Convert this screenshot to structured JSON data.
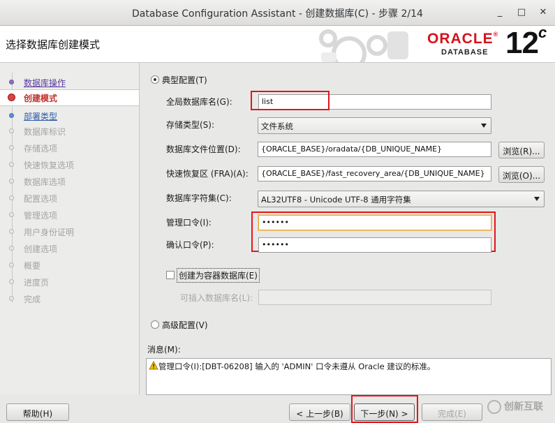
{
  "window": {
    "title": "Database Configuration Assistant - 创建数据库(C) - 步骤 2/14",
    "minimize": "_",
    "maximize": "□",
    "close": "✕"
  },
  "header": {
    "heading": "选择数据库创建模式",
    "logo_oracle": "ORACLE",
    "logo_registered": "®",
    "logo_database": "DATABASE",
    "logo_version": "12",
    "logo_version_suffix": "c"
  },
  "nav": {
    "steps": [
      {
        "label": "数据库操作",
        "state": "done"
      },
      {
        "label": "创建模式",
        "state": "current"
      },
      {
        "label": "部署类型",
        "state": "link"
      },
      {
        "label": "数据库标识",
        "state": "disabled"
      },
      {
        "label": "存储选项",
        "state": "disabled"
      },
      {
        "label": "快速恢复选项",
        "state": "disabled"
      },
      {
        "label": "数据库选项",
        "state": "disabled"
      },
      {
        "label": "配置选项",
        "state": "disabled"
      },
      {
        "label": "管理选项",
        "state": "disabled"
      },
      {
        "label": "用户身份证明",
        "state": "disabled"
      },
      {
        "label": "创建选项",
        "state": "disabled"
      },
      {
        "label": "概要",
        "state": "disabled"
      },
      {
        "label": "进度页",
        "state": "disabled"
      },
      {
        "label": "完成",
        "state": "disabled"
      }
    ]
  },
  "form": {
    "typical_label": "典型配置(T)",
    "global_db_name_label": "全局数据库名(G):",
    "global_db_name_value": "list",
    "storage_type_label": "存储类型(S):",
    "storage_type_value": "文件系统",
    "db_file_location_label": "数据库文件位置(D):",
    "db_file_location_value": "{ORACLE_BASE}/oradata/{DB_UNIQUE_NAME}",
    "browse_r_label": "浏览(R)...",
    "fra_label": "快速恢复区 (FRA)(A):",
    "fra_value": "{ORACLE_BASE}/fast_recovery_area/{DB_UNIQUE_NAME}",
    "browse_o_label": "浏览(O)...",
    "charset_label": "数据库字符集(C):",
    "charset_value": "AL32UTF8 - Unicode UTF-8 通用字符集",
    "admin_pwd_label": "管理口令(I):",
    "admin_pwd_value": "••••••",
    "confirm_pwd_label": "确认口令(P):",
    "confirm_pwd_value": "••••••",
    "container_db_label": "创建为容器数据库(E)",
    "pluggable_db_label": "可插入数据库名(L):",
    "pluggable_db_value": "",
    "advanced_label": "高级配置(V)"
  },
  "messages": {
    "label": "消息(M):",
    "text": "管理口令(I):[DBT-06208] 输入的 'ADMIN' 口令未遵从 Oracle 建议的标准。"
  },
  "footer": {
    "help": "帮助(H)",
    "back": "< 上一步(B)",
    "next": "下一步(N) >",
    "finish": "完成(E)",
    "watermark": "创新互联"
  },
  "colors": {
    "highlight_red": "#e0161c",
    "oracle_red": "#d6121b",
    "current_step": "#c0302b"
  }
}
